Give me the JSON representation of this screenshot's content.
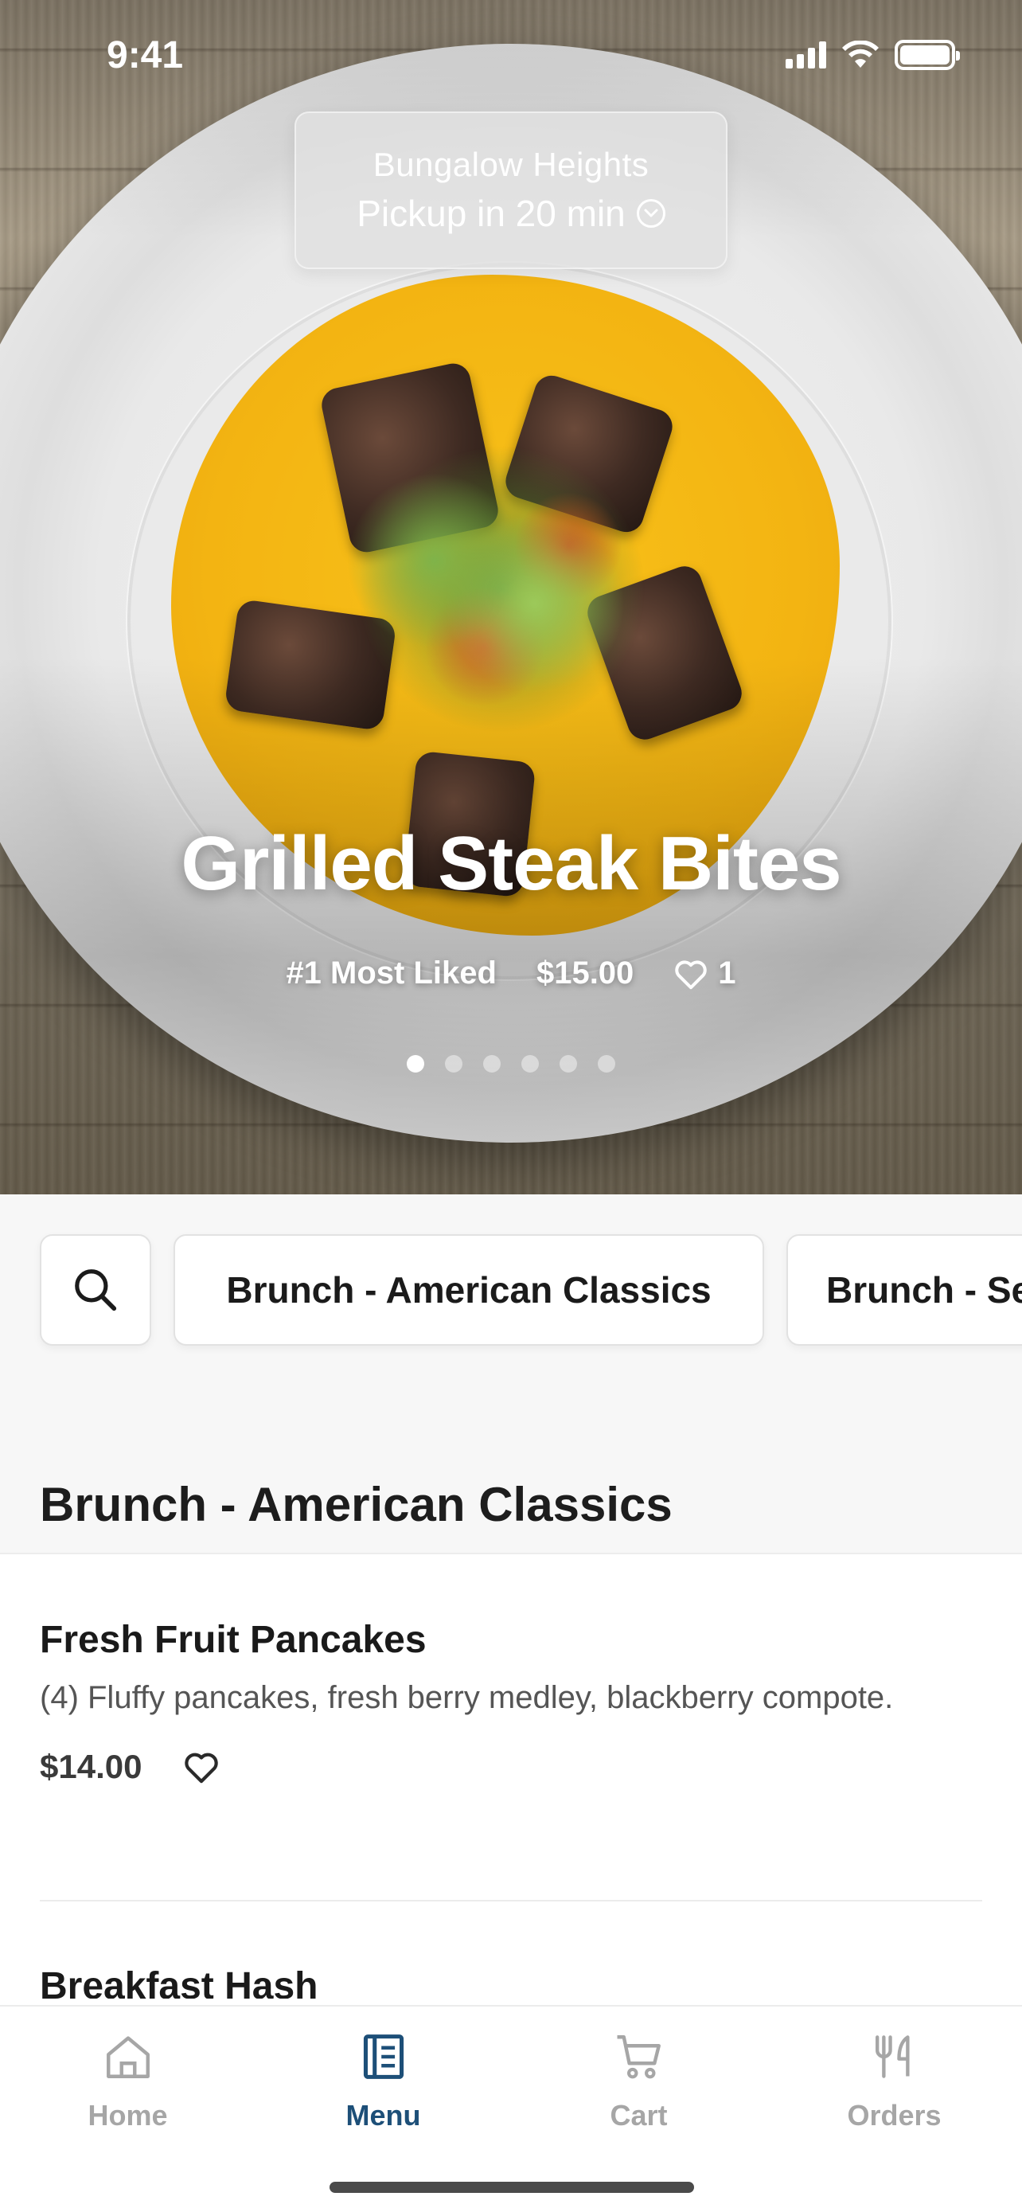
{
  "status_bar": {
    "time": "9:41"
  },
  "location": {
    "name": "Bungalow Heights",
    "pickup": "Pickup in 20 min"
  },
  "featured": {
    "title": "Grilled Steak Bites",
    "badge": "#1 Most Liked",
    "price": "$15.00",
    "likes": "1",
    "carousel_total": 6,
    "carousel_active": 1
  },
  "categories": {
    "search_icon": "search-icon",
    "items": [
      "Brunch - American Classics",
      "Brunch - Se"
    ]
  },
  "section": {
    "title": "Brunch - American Classics"
  },
  "menu_items": [
    {
      "name": "Fresh Fruit Pancakes",
      "description": "(4) Fluffy pancakes, fresh berry medley, blackberry compote.",
      "price": "$14.00"
    },
    {
      "name": "Breakfast Hash"
    }
  ],
  "tab_bar": {
    "tabs": [
      {
        "label": "Home",
        "icon": "home-icon"
      },
      {
        "label": "Menu",
        "icon": "menu-book-icon"
      },
      {
        "label": "Cart",
        "icon": "cart-icon"
      },
      {
        "label": "Orders",
        "icon": "utensils-icon"
      }
    ],
    "active": "Menu"
  },
  "colors": {
    "accent": "#1d4f78",
    "inactive": "#a6a6a6",
    "background": "#f7f7f7"
  }
}
